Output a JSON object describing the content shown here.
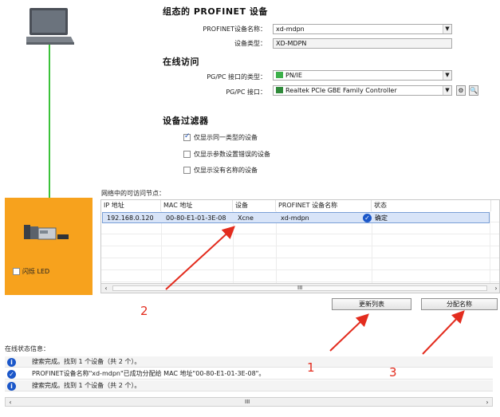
{
  "device_panel": {
    "flash_led_label": "闪烁 LED"
  },
  "config": {
    "heading": "组态的 PROFINET 设备",
    "device_name_label": "PROFINET设备名称：",
    "device_name_value": "xd-mdpn",
    "device_type_label": "设备类型：",
    "device_type_value": "XD-MDPN"
  },
  "online": {
    "heading": "在线访问",
    "interface_type_label": "PG/PC 接口的类型：",
    "interface_type_value": "PN/IE",
    "interface_label": "PG/PC 接口：",
    "interface_value": "Realtek PCIe GBE Family Controller"
  },
  "filter": {
    "heading": "设备过滤器",
    "options": [
      {
        "label": "仅显示同一类型的设备",
        "checked": true
      },
      {
        "label": "仅显示参数设置错误的设备",
        "checked": false
      },
      {
        "label": "仅显示没有名称的设备",
        "checked": false
      }
    ]
  },
  "nodes": {
    "caption": "网络中的可访问节点：",
    "columns": [
      "IP 地址",
      "MAC 地址",
      "设备",
      "PROFINET 设备名称",
      "状态"
    ],
    "rows": [
      {
        "ip": "192.168.0.120",
        "mac": "00-80-E1-01-3E-08",
        "device": "Xcne",
        "name": "xd-mdpn",
        "status": "确定"
      }
    ],
    "scroll_label": "III"
  },
  "buttons": {
    "refresh": "更新列表",
    "assign": "分配名称"
  },
  "status": {
    "caption": "在线状态信息：",
    "messages": [
      "搜索完成。找到 1 个设备（共 2 个）。",
      "PROFINET设备名称\"xd-mdpn\"已成功分配给 MAC 地址\"00-80-E1-01-3E-08\"。",
      "搜索完成。找到 1 个设备（共 2 个）。"
    ]
  },
  "annotations": [
    "1",
    "2",
    "3"
  ],
  "colors": {
    "accent_orange": "#f7a21d",
    "link_green": "#3cc23a",
    "arrow_red": "#e32c1e",
    "info_blue": "#1b57c9",
    "selected_row": "#d8e4f8"
  }
}
